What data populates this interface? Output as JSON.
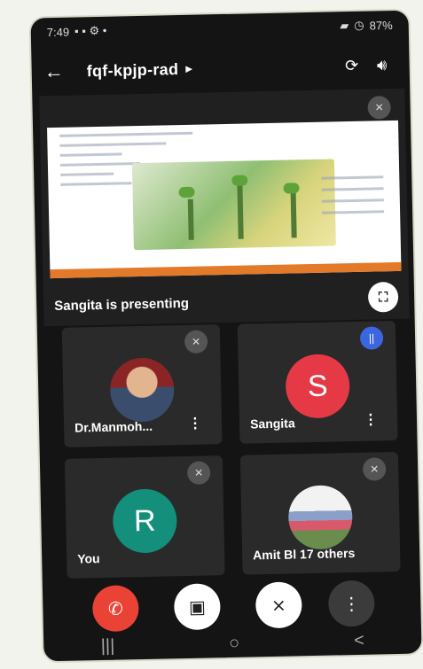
{
  "status_bar": {
    "time": "7:49",
    "battery": "87%"
  },
  "header": {
    "meeting_code": "fqf-kpjp-rad",
    "icons": [
      "back-arrow-icon",
      "switch-camera-icon",
      "speaker-icon"
    ]
  },
  "presentation": {
    "presenter_text": "Sangita is presenting"
  },
  "participants": [
    {
      "name": "Dr.Manmoh...",
      "avatar_type": "photo",
      "mic": "muted"
    },
    {
      "name": "Sangita",
      "initial": "S",
      "avatar_color": "#e63946",
      "mic": "speaking"
    },
    {
      "name": "You",
      "initial": "R",
      "avatar_color": "#138f7b",
      "mic": "muted"
    },
    {
      "name": "Amit Bl",
      "others_label": "17 others",
      "avatar_type": "group-photo",
      "mic": "muted"
    }
  ],
  "controls": {
    "end_call_color": "#ea4335",
    "icons": [
      "end-call-icon",
      "camera-off-icon",
      "mic-off-icon",
      "more-icon"
    ]
  },
  "nav_buttons": {
    "recent": "|||",
    "home": "○",
    "back": "<"
  }
}
